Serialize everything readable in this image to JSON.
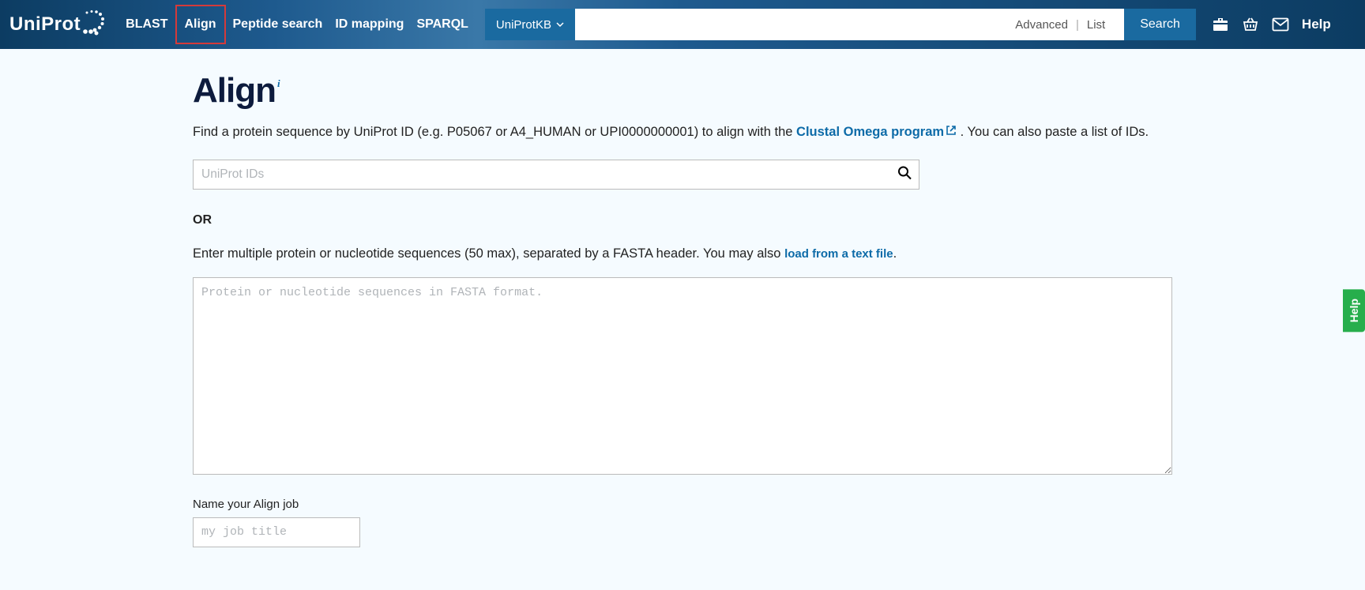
{
  "header": {
    "logo_text": "UniProt",
    "nav": [
      "BLAST",
      "Align",
      "Peptide search",
      "ID mapping",
      "SPARQL"
    ],
    "highlighted_nav_index": 1,
    "db_select": "UniProtKB",
    "advanced": "Advanced",
    "list": "List",
    "search_btn": "Search",
    "help": "Help"
  },
  "main": {
    "title": "Align",
    "intro_pre": "Find a protein sequence by UniProt ID (e.g. P05067 or A4_HUMAN or UPI0000000001) to align with the ",
    "intro_link": "Clustal Omega program",
    "intro_post": " . You can also paste a list of IDs.",
    "id_placeholder": "UniProt IDs",
    "or": "OR",
    "instr_pre": "Enter multiple protein or nucleotide sequences (50 max), separated by a FASTA header. You may also ",
    "instr_link": "load from a text file",
    "instr_post": ".",
    "fasta_placeholder": "Protein or nucleotide sequences in FASTA format.",
    "job_label": "Name your Align job",
    "job_placeholder": "my job title"
  },
  "side_help": "Help"
}
